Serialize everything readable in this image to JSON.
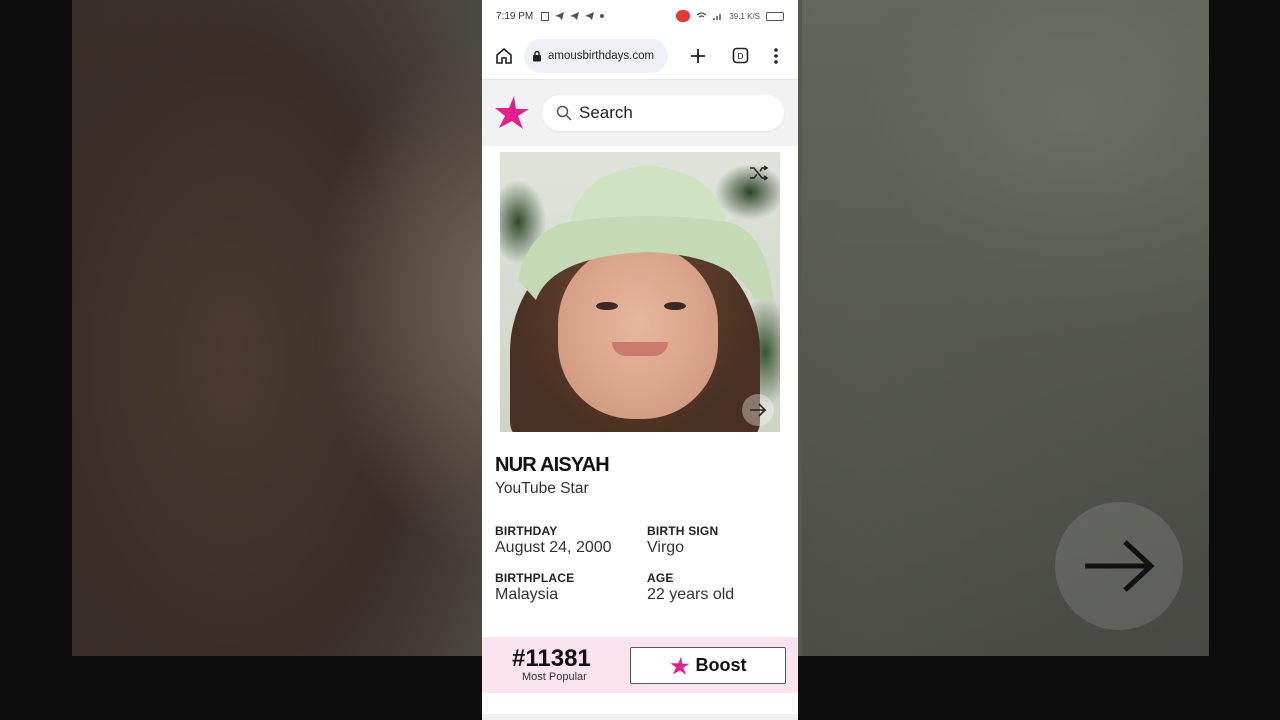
{
  "status_bar": {
    "time": "7:19 PM",
    "signal_text": "39.1 K/S"
  },
  "browser": {
    "url": "amousbirthdays.com"
  },
  "site": {
    "search_placeholder": "Search",
    "brand_color": "#e2208d"
  },
  "profile": {
    "name": "NUR AISYAH",
    "profession": "YouTube Star",
    "facts": [
      {
        "label": "BIRTHDAY",
        "value": "August 24, 2000"
      },
      {
        "label": "BIRTH SIGN",
        "value": "Virgo"
      },
      {
        "label": "BIRTHPLACE",
        "value": "Malaysia"
      },
      {
        "label": "AGE",
        "value": "22 years old"
      }
    ]
  },
  "rank": {
    "number": "#11381",
    "label": "Most Popular",
    "boost_label": "Boost"
  },
  "icons": [
    "home-icon",
    "lock-icon",
    "plus-icon",
    "tabs-icon",
    "menu-icon",
    "search-icon",
    "logo-star-icon",
    "shuffle-icon",
    "next-arrow-icon",
    "boost-star-icon"
  ]
}
